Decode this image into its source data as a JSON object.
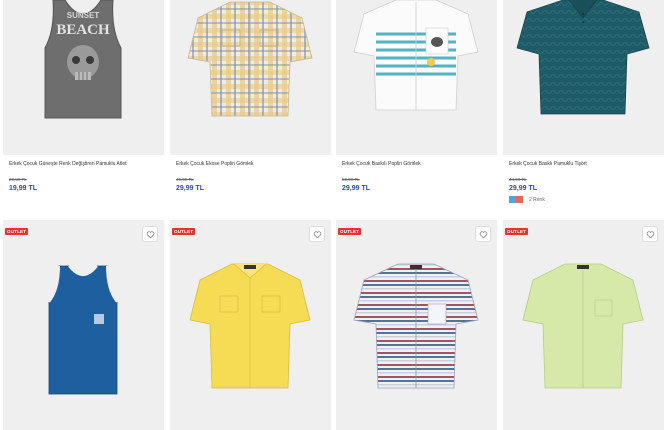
{
  "row1": [
    {
      "title": "Erkek Çocuk Güneşte Renk Değiştiren Pamuklu Atlet",
      "old_price": "29,99 TL",
      "price": "19,99 TL",
      "print_line1": "SUNSET",
      "print_line2": "BEACH"
    },
    {
      "title": "Erkek Çocuk Ekose Poplin Gömlek",
      "old_price": "49,99 TL",
      "price": "29,99 TL"
    },
    {
      "title": "Erkek Çocuk Baskılı Poplin Gömlek",
      "old_price": "59,99 TL",
      "price": "29,99 TL"
    },
    {
      "title": "Erkek Çocuk Basklı Pamuklu Tişört",
      "old_price": "44,99 TL",
      "price": "29,99 TL",
      "color_count": "2 Renk",
      "swatch_colors": [
        "#5aa0d8",
        "#e36b5a"
      ]
    }
  ],
  "row2": [
    {
      "badge": "OUTLET",
      "product": "blue-tank-top"
    },
    {
      "badge": "OUTLET",
      "product": "yellow-shirt"
    },
    {
      "badge": "OUTLET",
      "product": "striped-shirt"
    },
    {
      "badge": "OUTLET",
      "product": "green-shirt"
    }
  ],
  "colors": {
    "price_blue": "#2152a6",
    "badge_red": "#e3342f",
    "image_bg": "#efefef"
  }
}
